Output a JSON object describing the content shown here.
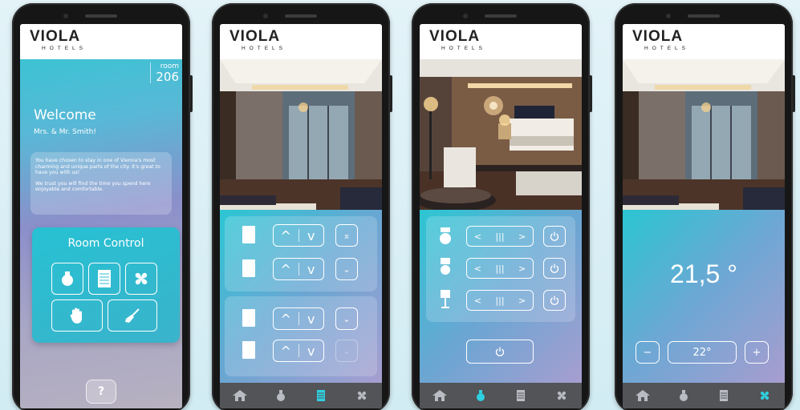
{
  "brand": {
    "name": "VIOLA",
    "sub": "HOTELS"
  },
  "welcome": {
    "room_label": "room",
    "room_number": "206",
    "title": "Welcome",
    "guest": "Mrs. & Mr. Smith!",
    "intro_p1": "You have chosen to stay in one of Vienna's most charming and unique parts of the city. It's great to have you with us!",
    "intro_p2": "We trust you will find the time you spend here enjoyable and comfortable.",
    "room_control_title": "Room Control",
    "help_label": "?"
  },
  "blinds": {
    "up_glyph": "^",
    "down_glyph": "v",
    "to_top_glyph": "⌅",
    "to_bottom_glyph": "⌄"
  },
  "lights": {
    "dim_left": "<",
    "dim_right": ">",
    "dim_bars": "|||"
  },
  "climate": {
    "current_temp": "21,5 °",
    "target_temp": "22°",
    "minus_label": "−",
    "plus_label": "+"
  },
  "nav": [
    "home-icon",
    "light-bulb-icon",
    "blinds-icon",
    "fan-icon"
  ],
  "colors": {
    "accent": "#27c1d3",
    "nav_active": "#2fd0df",
    "nav_idle": "#b9bcc2"
  }
}
